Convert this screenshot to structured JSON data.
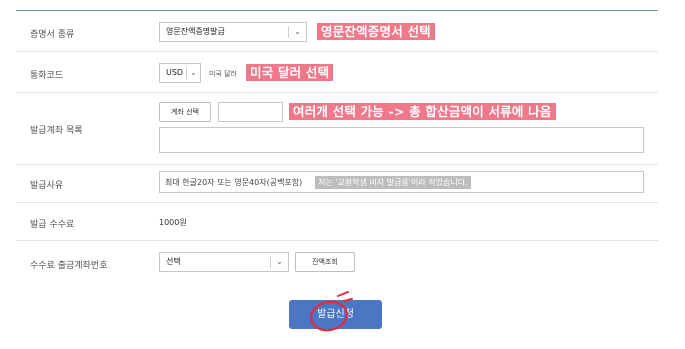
{
  "form": {
    "cert_type": {
      "label": "증명서 종류",
      "selected": "영문잔액증명발급",
      "annotation": "영문잔액증명서 선택"
    },
    "currency": {
      "label": "통화코드",
      "selected": "USD",
      "text": "미국 달러",
      "annotation": "미국 달러 선택"
    },
    "accounts": {
      "label": "발급계좌 목록",
      "button": "계좌 선택",
      "annotation": "여러개 선택 가능 -> 총 합산금액이 서류에 나옴"
    },
    "reason": {
      "label": "발급사유",
      "placeholder": "최대 한글20자 또는 영문40자(공백포함)",
      "hint": "저는 '교환학생 비자 발급용'이라 적었습니다."
    },
    "fee": {
      "label": "발급 수수료",
      "value": "1000원"
    },
    "fee_account": {
      "label": "수수료 출금계좌번호",
      "selected": "선택",
      "balance_button": "잔액조회"
    }
  },
  "submit_label": "발급신청",
  "colors": {
    "annotation": "#f0788a",
    "submit": "#4a76c4",
    "circle": "#e8283c"
  }
}
